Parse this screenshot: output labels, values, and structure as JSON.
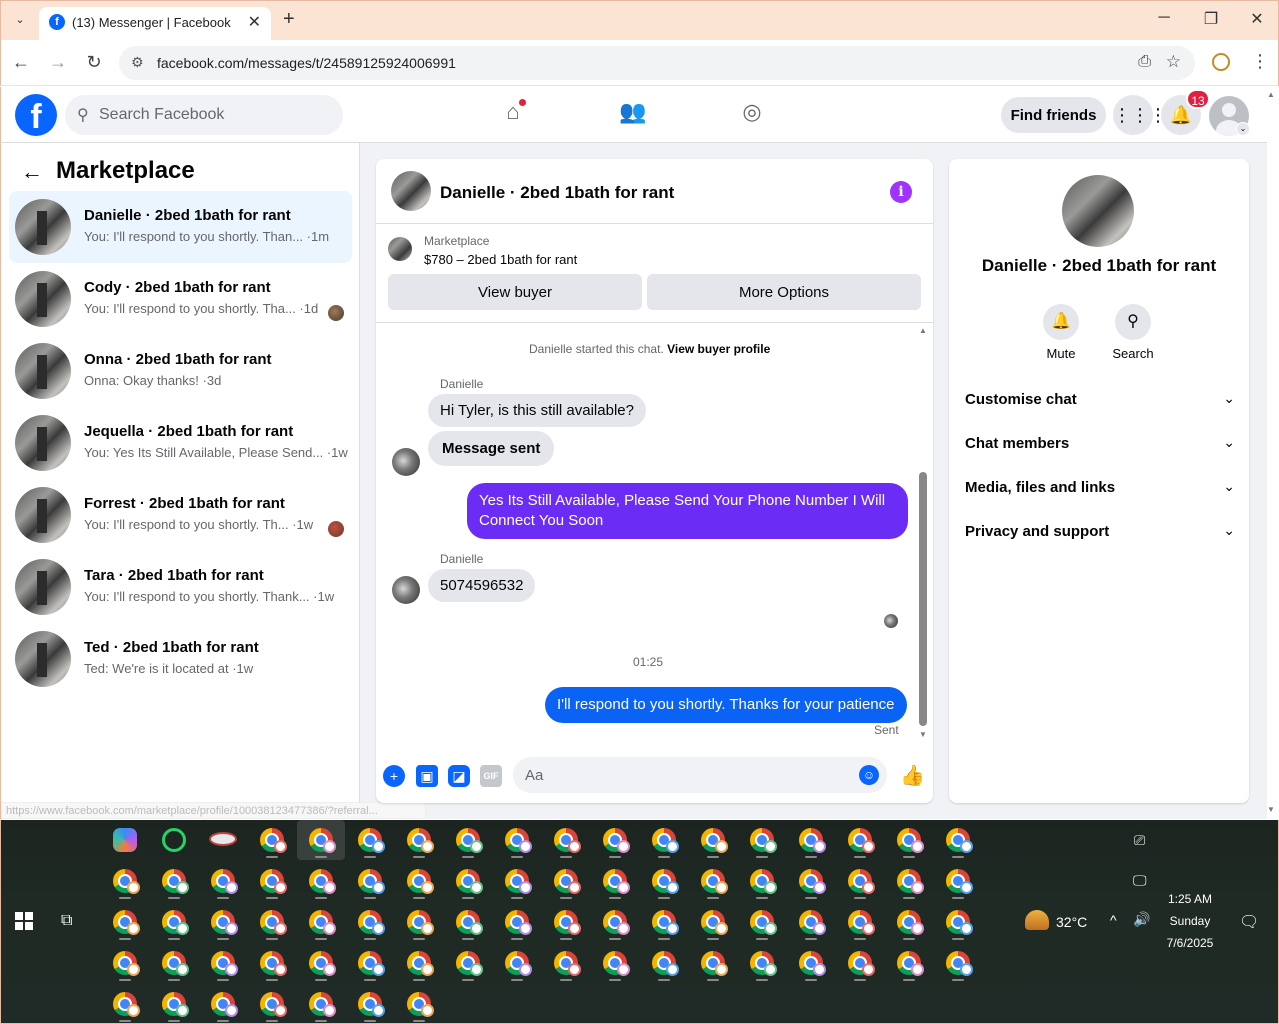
{
  "browser": {
    "tab_title": "(13) Messenger | Facebook",
    "tab_favicon": "f",
    "url": "facebook.com/messages/t/24589125924006991",
    "status_url": "https://www.facebook.com/marketplace/profile/100038123477386/?referral..."
  },
  "facebook": {
    "search_placeholder": "Search Facebook",
    "find_friends_label": "Find friends",
    "notification_count": "13",
    "logo_letter": "f"
  },
  "marketplace": {
    "title": "Marketplace",
    "conversations": [
      {
        "name": "Danielle · 2bed 1bath for rant",
        "preview": "You: I'll respond to you shortly. Than... ·1m",
        "active": true
      },
      {
        "name": "Cody · 2bed 1bath for rant",
        "preview": "You: I'll respond to you shortly. Tha... ·1d",
        "active": false
      },
      {
        "name": "Onna · 2bed 1bath for rant",
        "preview": "Onna: Okay thanks! ·3d",
        "active": false
      },
      {
        "name": "Jequella · 2bed 1bath for rant",
        "preview": "You: Yes Its Still Available, Please Send... ·1w",
        "active": false
      },
      {
        "name": "Forrest · 2bed 1bath for rant",
        "preview": "You: I'll respond to you shortly. Th... ·1w",
        "active": false
      },
      {
        "name": "Tara · 2bed 1bath for rant",
        "preview": "You: I'll respond to you shortly. Thank... ·1w",
        "active": false
      },
      {
        "name": "Ted · 2bed 1bath for rant",
        "preview": "Ted: We're is it located at ·1w",
        "active": false
      }
    ]
  },
  "chat": {
    "title": "Danielle · 2bed 1bath for rant",
    "listing_category": "Marketplace",
    "listing_price": "$780 – 2bed 1bath for rant",
    "view_buyer_label": "View buyer",
    "more_options_label": "More Options",
    "system_text": "Danielle started this chat.",
    "view_buyer_profile_label": "View buyer profile",
    "messages": [
      {
        "sender": "Danielle",
        "text": "Hi Tyler, is this still available?"
      },
      {
        "text": "Message sent"
      },
      {
        "text": "Yes Its Still Available, Please Send Your Phone Number I Will Connect You Soon"
      },
      {
        "sender": "Danielle",
        "text": "5074596532"
      },
      {
        "text": "I'll respond to you shortly. Thanks for your patience"
      }
    ],
    "timestamp": "01:25",
    "sent_status": "Sent",
    "composer_placeholder": "Aa",
    "colors": {
      "outgoing_purple": "#6b2cf5",
      "outgoing_blue": "#0a63f5",
      "accent": "#0866ff"
    }
  },
  "right_panel": {
    "name": "Danielle · 2bed 1bath for rant",
    "mute_label": "Mute",
    "search_label": "Search",
    "sections": [
      "Customise chat",
      "Chat members",
      "Media, files and links",
      "Privacy and support"
    ]
  },
  "taskbar": {
    "temperature": "32°C",
    "time": "1:25 AM",
    "day": "Sunday",
    "date": "7/6/2025"
  }
}
